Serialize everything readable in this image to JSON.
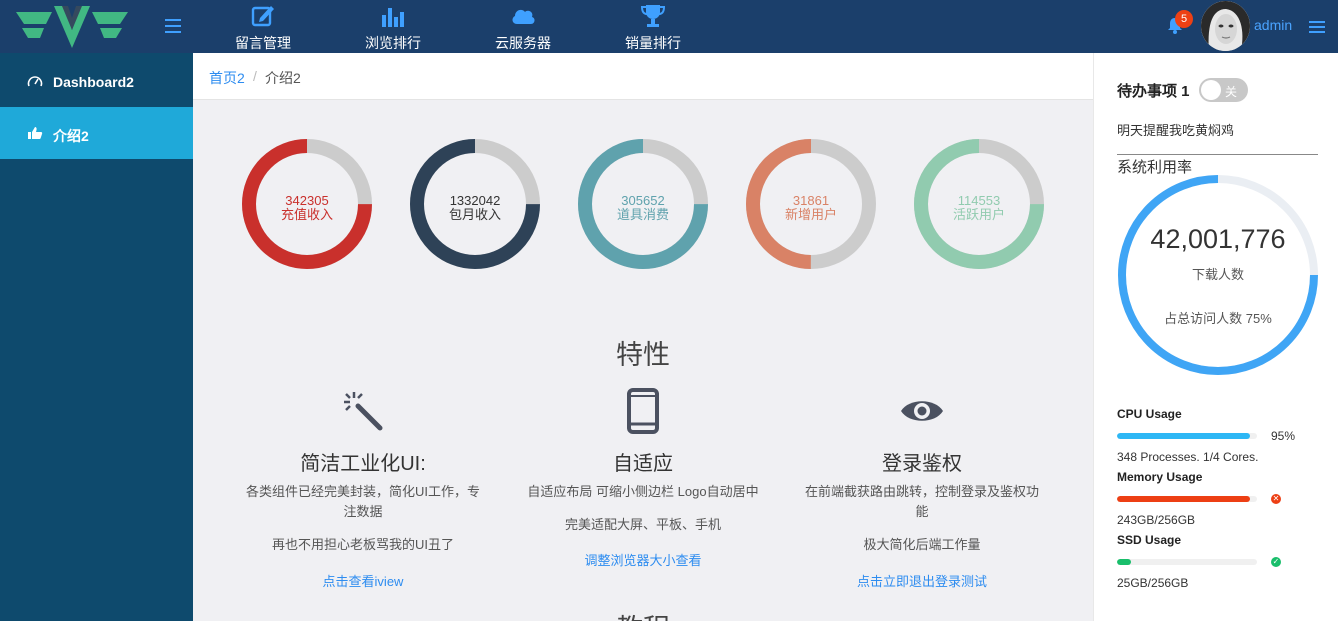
{
  "topnav": [
    {
      "label": "留言管理",
      "icon": "edit-icon"
    },
    {
      "label": "浏览排行",
      "icon": "bar-chart-icon"
    },
    {
      "label": "云服务器",
      "icon": "cloud-icon"
    },
    {
      "label": "销量排行",
      "icon": "trophy-icon"
    }
  ],
  "header": {
    "notification_count": "5",
    "username": "admin"
  },
  "sidebar": {
    "items": [
      {
        "label": "Dashboard2",
        "icon": "speedometer-icon",
        "active": false
      },
      {
        "label": "介绍2",
        "icon": "thumbs-up-icon",
        "active": true
      }
    ]
  },
  "breadcrumb": {
    "home": "首页2",
    "separator": "/",
    "current": "介绍2"
  },
  "stats": [
    {
      "value": "342305",
      "label": "充值收入",
      "color": "#c9302c",
      "fraction": 0.75
    },
    {
      "value": "1332042",
      "label": "包月收入",
      "color": "#2e4257",
      "fraction": 0.75
    },
    {
      "value": "305652",
      "label": "道具消费",
      "color": "#5fa2ad",
      "fraction": 0.75
    },
    {
      "value": "31861",
      "label": "新增用户",
      "color": "#d98266",
      "fraction": 0.5
    },
    {
      "value": "114553",
      "label": "活跃用户",
      "color": "#91cbaf",
      "fraction": 0.75
    }
  ],
  "features": {
    "title": "特性",
    "items": [
      {
        "icon": "magic-wand-icon",
        "heading": "简洁工业化UI:",
        "lines": [
          "各类组件已经完美封装，简化UI工作，专",
          "注数据",
          "再也不用担心老板骂我的UI丑了"
        ],
        "link": "点击查看iview"
      },
      {
        "icon": "phone-icon",
        "heading": "自适应",
        "lines": [
          "自适应布局 可缩小侧边栏 Logo自动居中",
          "完美适配大屏、平板、手机"
        ],
        "link": "调整浏览器大小查看"
      },
      {
        "icon": "eye-icon",
        "heading": "登录鉴权",
        "lines": [
          "在前端截获路由跳转，控制登录及鉴权功",
          "能",
          "极大简化后端工作量"
        ],
        "link": "点击立即退出登录测试"
      }
    ],
    "next_title": "教程"
  },
  "right_panel": {
    "todo_title": "待办事项 1",
    "toggle_label": "关",
    "todo_text": "明天提醒我吃黄焖鸡",
    "sys_title": "系统利用率",
    "big_number": "42,001,776",
    "big_label": "下载人数",
    "big_sub": "占总访问人数 75%",
    "big_fraction": 0.75,
    "usages": [
      {
        "title": "CPU Usage",
        "percent": 95,
        "color": "#2db7f5",
        "right": "95%",
        "info": "348 Processes. 1/4 Cores."
      },
      {
        "title": "Memory Usage",
        "percent": 95,
        "color": "#ed3f14",
        "status": "error",
        "info": "243GB/256GB"
      },
      {
        "title": "SSD Usage",
        "percent": 10,
        "color": "#19be6b",
        "status": "ok",
        "info": "25GB/256GB"
      }
    ]
  }
}
